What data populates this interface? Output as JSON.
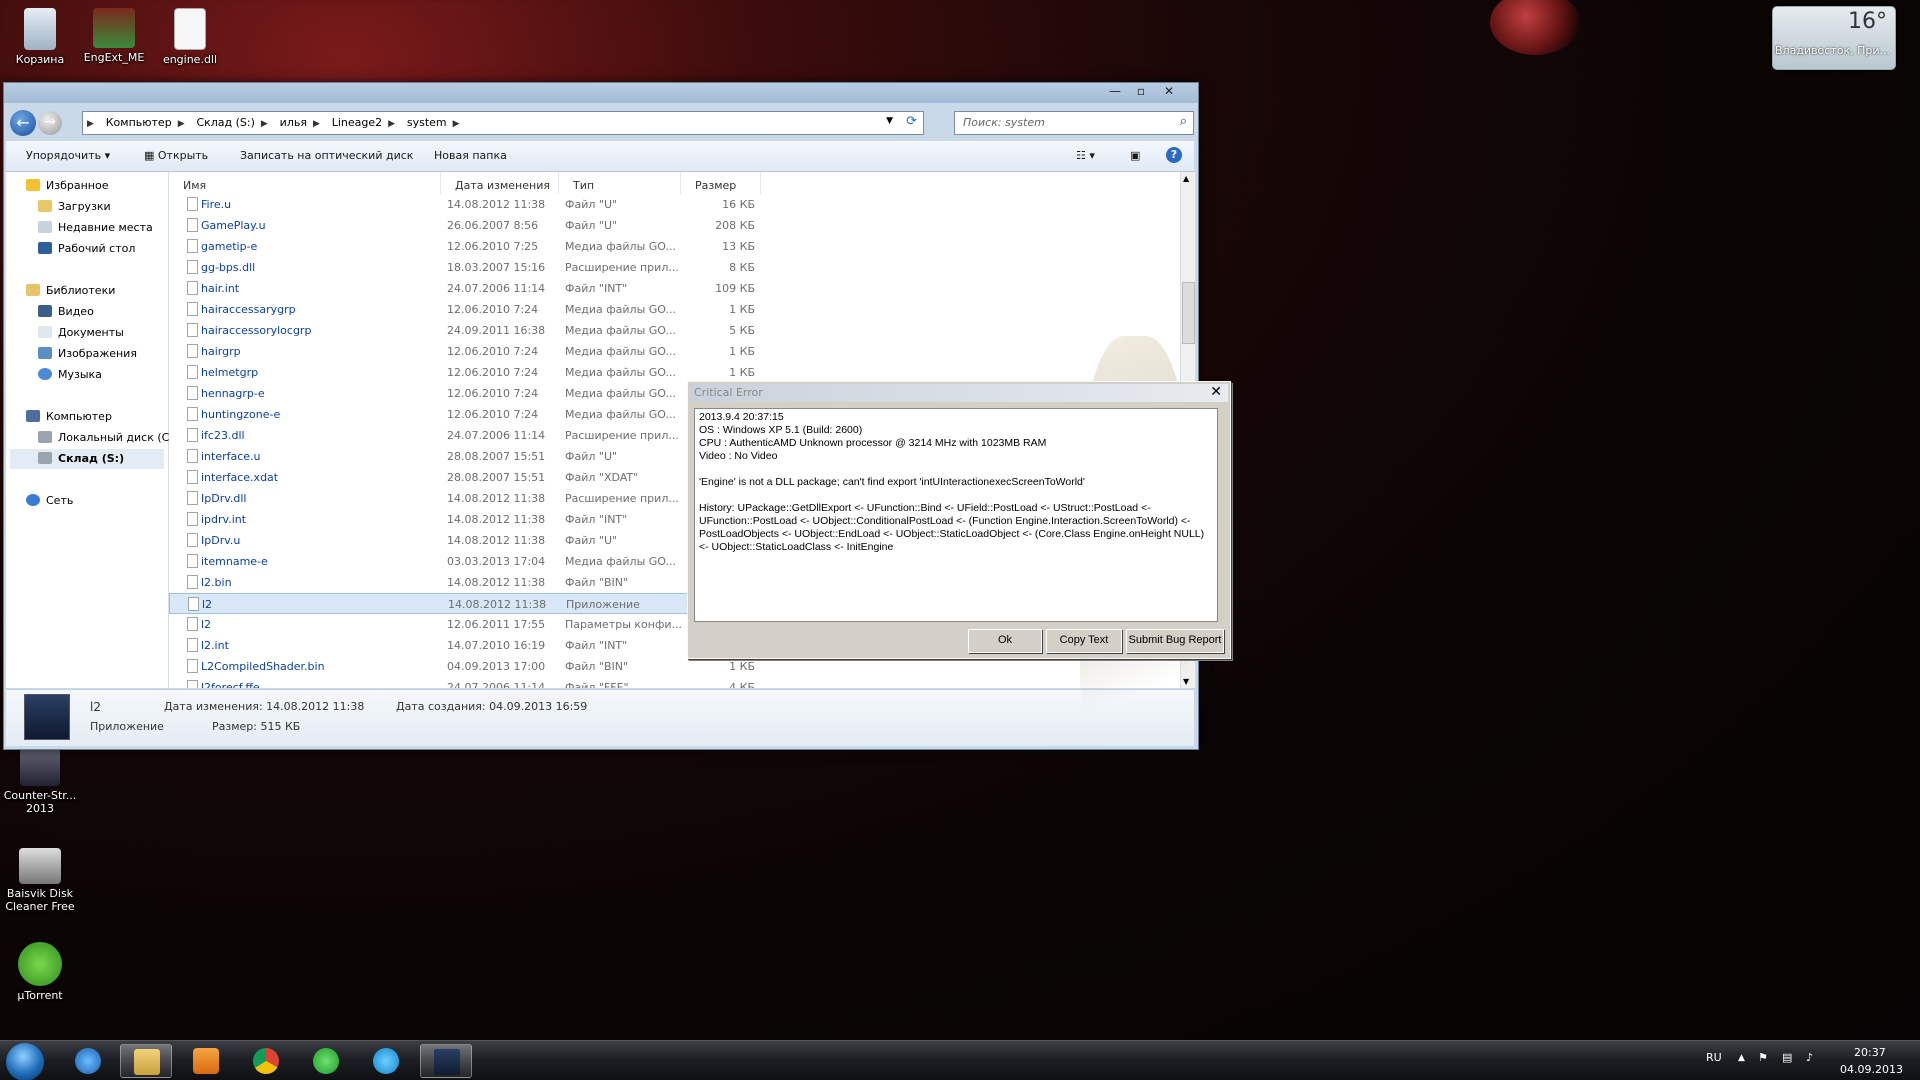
{
  "desktop": {
    "icons": [
      {
        "label": "Корзина"
      },
      {
        "label": "EngExt_ME"
      },
      {
        "label": "engine.dll"
      },
      {
        "label": "Counter-Str... 2013"
      },
      {
        "label": "Baisvik Disk Cleaner Free"
      },
      {
        "label": "µTorrent"
      }
    ],
    "weather": {
      "temp": "16°",
      "city": "Владивосток, При..."
    }
  },
  "explorer": {
    "breadcrumbs": [
      "Компьютер",
      "Склад (S:)",
      "илья",
      "Lineage2",
      "system"
    ],
    "search_placeholder": "Поиск: system",
    "toolbar": {
      "organize": "Упорядочить",
      "open": "Открыть",
      "burn": "Записать на оптический диск",
      "new_folder": "Новая папка"
    },
    "nav": {
      "favorites": "Избранное",
      "downloads": "Загрузки",
      "recent": "Недавние места",
      "desktop": "Рабочий стол",
      "libraries": "Библиотеки",
      "video": "Видео",
      "documents": "Документы",
      "images": "Изображения",
      "music": "Музыка",
      "computer": "Компьютер",
      "local_disk": "Локальный диск (C",
      "storage": "Склад (S:)",
      "network": "Сеть"
    },
    "columns": {
      "name": "Имя",
      "date": "Дата изменения",
      "type": "Тип",
      "size": "Размер"
    },
    "files": [
      {
        "name": "Fire.u",
        "date": "14.08.2012 11:38",
        "type": "Файл \"U\"",
        "size": "16 КБ"
      },
      {
        "name": "GamePlay.u",
        "date": "26.06.2007 8:56",
        "type": "Файл \"U\"",
        "size": "208 КБ"
      },
      {
        "name": "gametip-e",
        "date": "12.06.2010 7:25",
        "type": "Медиа файлы GO...",
        "size": "13 КБ"
      },
      {
        "name": "gg-bps.dll",
        "date": "18.03.2007 15:16",
        "type": "Расширение прил...",
        "size": "8 КБ"
      },
      {
        "name": "hair.int",
        "date": "24.07.2006 11:14",
        "type": "Файл \"INT\"",
        "size": "109 КБ"
      },
      {
        "name": "hairaccessarygrp",
        "date": "12.06.2010 7:24",
        "type": "Медиа файлы GO...",
        "size": "1 КБ"
      },
      {
        "name": "hairaccessorylocgrp",
        "date": "24.09.2011 16:38",
        "type": "Медиа файлы GO...",
        "size": "5 КБ"
      },
      {
        "name": "hairgrp",
        "date": "12.06.2010 7:24",
        "type": "Медиа файлы GO...",
        "size": "1 КБ"
      },
      {
        "name": "helmetgrp",
        "date": "12.06.2010 7:24",
        "type": "Медиа файлы GO...",
        "size": "1 КБ"
      },
      {
        "name": "hennagrp-e",
        "date": "12.06.2010 7:24",
        "type": "Медиа файлы GO...",
        "size": ""
      },
      {
        "name": "huntingzone-e",
        "date": "12.06.2010 7:24",
        "type": "Медиа файлы GO...",
        "size": ""
      },
      {
        "name": "ifc23.dll",
        "date": "24.07.2006 11:14",
        "type": "Расширение прил...",
        "size": ""
      },
      {
        "name": "interface.u",
        "date": "28.08.2007 15:51",
        "type": "Файл \"U\"",
        "size": ""
      },
      {
        "name": "interface.xdat",
        "date": "28.08.2007 15:51",
        "type": "Файл \"XDAT\"",
        "size": ""
      },
      {
        "name": "IpDrv.dll",
        "date": "14.08.2012 11:38",
        "type": "Расширение прил...",
        "size": ""
      },
      {
        "name": "ipdrv.int",
        "date": "14.08.2012 11:38",
        "type": "Файл \"INT\"",
        "size": ""
      },
      {
        "name": "IpDrv.u",
        "date": "14.08.2012 11:38",
        "type": "Файл \"U\"",
        "size": ""
      },
      {
        "name": "itemname-e",
        "date": "03.03.2013 17:04",
        "type": "Медиа файлы GO...",
        "size": ""
      },
      {
        "name": "l2.bin",
        "date": "14.08.2012 11:38",
        "type": "Файл \"BIN\"",
        "size": ""
      },
      {
        "name": "l2",
        "date": "14.08.2012 11:38",
        "type": "Приложение",
        "size": ""
      },
      {
        "name": "l2",
        "date": "12.06.2011 17:55",
        "type": "Параметры конфи...",
        "size": ""
      },
      {
        "name": "l2.int",
        "date": "14.07.2010 16:19",
        "type": "Файл \"INT\"",
        "size": ""
      },
      {
        "name": "L2CompiledShader.bin",
        "date": "04.09.2013 17:00",
        "type": "Файл \"BIN\"",
        "size": "1 КБ"
      },
      {
        "name": "l2forecf.ffe",
        "date": "24.07.2006 11:14",
        "type": "Файл \"FFE\"",
        "size": "4 КБ"
      }
    ],
    "selected_index": 19,
    "details": {
      "name": "l2",
      "type": "Приложение",
      "modified_label": "Дата изменения:",
      "modified": "14.08.2012 11:38",
      "size_label": "Размер:",
      "size": "515 КБ",
      "created_label": "Дата создания:",
      "created": "04.09.2013 16:59"
    }
  },
  "dialog": {
    "title": "Critical Error",
    "lines": [
      "2013.9.4 20:37:15",
      "OS : Windows XP 5.1 (Build: 2600)",
      "CPU : AuthenticAMD Unknown processor @ 3214 MHz with 1023MB RAM",
      "Video : No Video",
      "",
      "'Engine' is not a DLL package; can't find export 'intUInteractionexecScreenToWorld'",
      "",
      "History: UPackage::GetDllExport <- UFunction::Bind <- UField::PostLoad <- UStruct::PostLoad <-",
      "UFunction::PostLoad <- UObject::ConditionalPostLoad <- (Function Engine.Interaction.ScreenToWorld) <-",
      "PostLoadObjects <- UObject::EndLoad <- UObject::StaticLoadObject <- (Core.Class Engine.onHeight NULL)",
      "<- UObject::StaticLoadClass <- InitEngine"
    ],
    "buttons": {
      "ok": "Ok",
      "copy": "Copy Text",
      "report": "Submit Bug Report"
    }
  },
  "taskbar": {
    "lang": "RU",
    "time": "20:37",
    "date": "04.09.2013"
  }
}
